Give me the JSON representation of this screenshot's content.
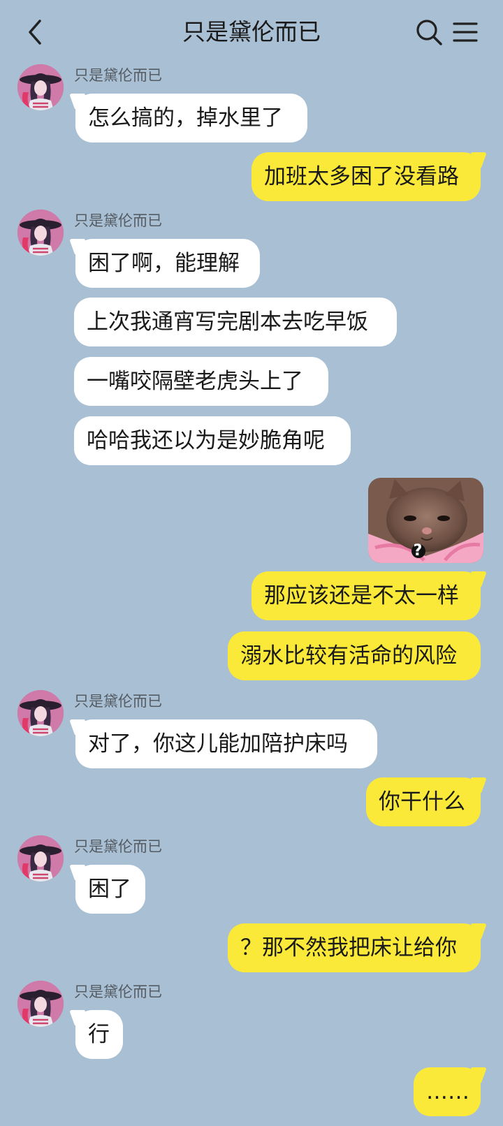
{
  "header": {
    "title": "只是黛伦而已",
    "back_icon": "chevron-left-icon",
    "search_icon": "search-icon",
    "menu_icon": "menu-icon"
  },
  "messages": [
    {
      "side": "in",
      "sender": "只是黛伦而已",
      "text": "怎么搞的，掉水里了"
    },
    {
      "side": "out",
      "text": "加班太多困了没看路"
    },
    {
      "side": "in",
      "sender": "只是黛伦而已",
      "text": "困了啊，能理解"
    },
    {
      "side": "in",
      "text": "上次我通宵写完剧本去吃早饭"
    },
    {
      "side": "in",
      "text": "一嘴咬隔壁老虎头上了"
    },
    {
      "side": "in",
      "text": "哈哈我还以为是妙脆角呢"
    },
    {
      "side": "out",
      "type": "sticker",
      "sticker": "sad-kitten-question-mark",
      "caption": "?"
    },
    {
      "side": "out",
      "text": "那应该还是不太一样"
    },
    {
      "side": "out",
      "text": "溺水比较有活命的风险"
    },
    {
      "side": "in",
      "sender": "只是黛伦而已",
      "text": "对了，你这儿能加陪护床吗"
    },
    {
      "side": "out",
      "text": "你干什么"
    },
    {
      "side": "in",
      "sender": "只是黛伦而已",
      "text": "困了"
    },
    {
      "side": "out",
      "text": "？那不然我把床让给你"
    },
    {
      "side": "in",
      "sender": "只是黛伦而已",
      "text": "行"
    },
    {
      "side": "out",
      "text": "……"
    }
  ],
  "colors": {
    "background": "#a9bfd3",
    "incoming_bubble": "#ffffff",
    "outgoing_bubble": "#fbe93a"
  }
}
